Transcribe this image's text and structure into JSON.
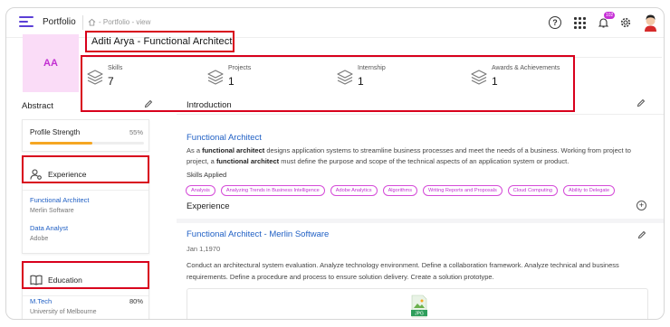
{
  "header": {
    "brand": "Portfolio",
    "breadcrumb": "- Portfolio - view",
    "notification_count": "102"
  },
  "profile": {
    "initials": "AA",
    "name": "Aditi Arya - Functional Architect"
  },
  "stats": [
    {
      "label": "Skills",
      "value": "7"
    },
    {
      "label": "Projects",
      "value": "1"
    },
    {
      "label": "Internship",
      "value": "1"
    },
    {
      "label": "Awards & Achievements",
      "value": "1"
    }
  ],
  "abstract": {
    "title": "Abstract"
  },
  "profile_strength": {
    "title": "Profile Strength",
    "percent_label": "55%",
    "percent": 55
  },
  "experience_card": {
    "title": "Experience",
    "items": [
      {
        "title": "Functional Architect",
        "subtitle": "Merlin Software"
      },
      {
        "title": "Data Analyst",
        "subtitle": "Adobe"
      }
    ]
  },
  "education_card": {
    "title": "Education",
    "items": [
      {
        "title": "M.Tech",
        "subtitle": "University of Melbourne",
        "score": "80%"
      }
    ]
  },
  "introduction": {
    "title": "Introduction",
    "role_title": "Functional Architect",
    "desc_p1": "As a ",
    "desc_b1": "functional architect",
    "desc_p2": " designs application systems to streamline business processes and meet the needs of a business. Working from project to project, a ",
    "desc_b2": "functional architect",
    "desc_p3": " must define the purpose and scope of the technical aspects of an application system or product.",
    "skills_label": "Skills Applied",
    "skills": [
      "Analysis",
      "Analyzing Trends in Business Intelligence",
      "Adobe Analytics",
      "Algorithms",
      "Writing Reports and Proposals",
      "Cloud Computing",
      "Ability to Delegate"
    ]
  },
  "experience_section": {
    "title": "Experience",
    "role": "Functional Architect - Merlin Software",
    "date": "Jan 1,1970",
    "description": "Conduct an architectural system evaluation. Analyze technology environment. Define a collaboration framework. Analyze technical and business requirements. Define a procedure and process to ensure solution delivery. Create a solution prototype.",
    "attachment_label": "JPG"
  },
  "colors": {
    "accent": "#5b3fd6",
    "link": "#1f5fc4",
    "chip": "#c22fd2",
    "highlight": "#d8001c",
    "progress": "#f5a623"
  }
}
